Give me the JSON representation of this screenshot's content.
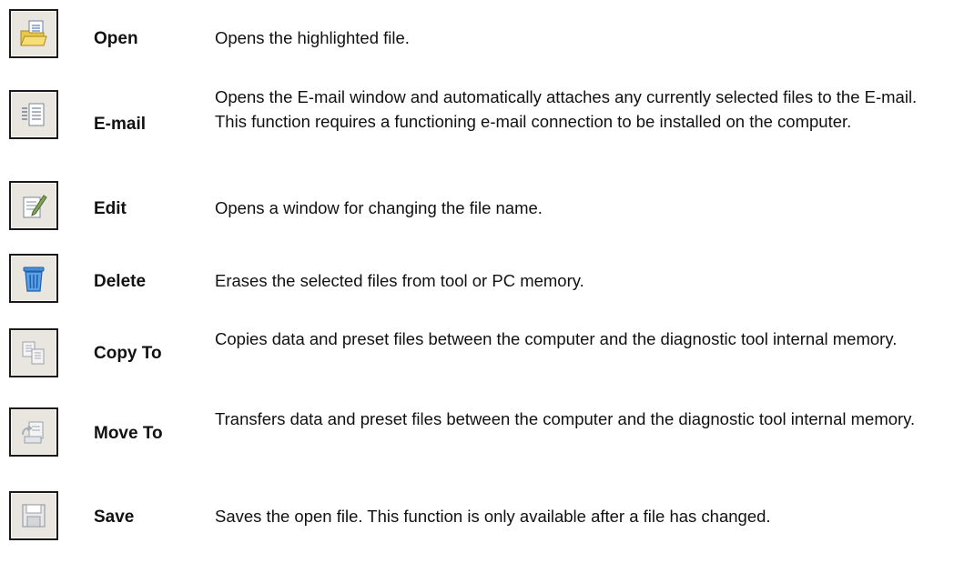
{
  "items": [
    {
      "icon": "open-folder-icon",
      "name": "Open",
      "description": "Opens the highlighted file."
    },
    {
      "icon": "email-icon",
      "name": "E-mail",
      "description": "Opens the E-mail window and automatically attaches any currently selected files to the E-mail. This function requires a functioning e-mail connection to be installed on the computer."
    },
    {
      "icon": "edit-icon",
      "name": "Edit",
      "description": "Opens a window for changing the file name."
    },
    {
      "icon": "trash-icon",
      "name": "Delete",
      "description": "Erases the selected files from tool or PC memory."
    },
    {
      "icon": "copy-to-icon",
      "name": "Copy To",
      "description": "Copies data and preset files between the computer and the diagnostic tool internal memory."
    },
    {
      "icon": "move-to-icon",
      "name": "Move To",
      "description": "Transfers data and preset files between the computer and the diagnostic tool internal memory."
    },
    {
      "icon": "save-icon",
      "name": "Save",
      "description": "Saves the open file. This function is only available after a file has changed."
    }
  ]
}
